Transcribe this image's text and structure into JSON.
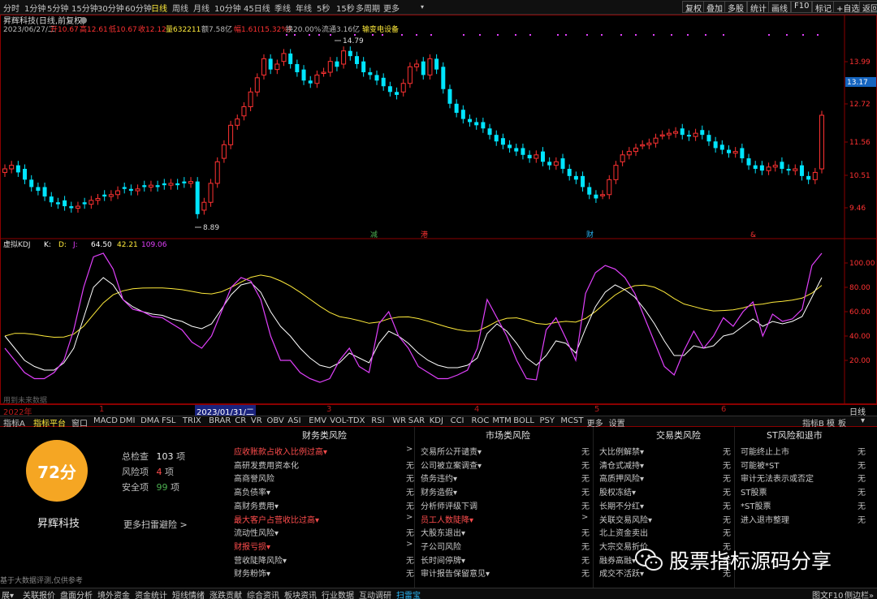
{
  "toolbar": {
    "periods": [
      "分时",
      "1分钟",
      "5分钟",
      "15分钟",
      "30分钟",
      "60分钟",
      "日线",
      "周线",
      "月线",
      "10分钟",
      "45日线",
      "季线",
      "年线",
      "5秒",
      "15秒",
      "多周期",
      "更多"
    ],
    "active_period": "日线",
    "right_buttons": [
      "复权",
      "叠加",
      "多股",
      "统计",
      "画线",
      "F10",
      "标记",
      "+自选",
      "返回"
    ]
  },
  "chart_header": {
    "title": "昇辉科技(日线,前复权)",
    "info_date": "2023/06/27/二",
    "info_open": "开10.67",
    "info_high": "高12.61",
    "info_low": "低10.67",
    "info_close": "收12.12",
    "info_vol": "量632211",
    "info_amount": "额7.58亿",
    "info_change": "幅1.61(15.32%)",
    "info_turnover": "换20.00%",
    "info_float": "流通3.16亿",
    "info_sector": "输变电设备",
    "high_marker": "14.79",
    "low_marker": "8.89",
    "price_ticks": [
      "13.99",
      "12.72",
      "11.56",
      "10.51",
      "9.46"
    ],
    "current_price": "13.17",
    "event_labels": [
      "减",
      "港",
      "财",
      "&"
    ]
  },
  "kdj": {
    "label": "虚拟KDJ",
    "legend_k": "K:",
    "legend_d": "D:",
    "legend_j": "J:",
    "value_1": "64.50",
    "value_2": "42.21",
    "value_3": "109.06",
    "ticks": [
      "100.00",
      "80.00",
      "60.00",
      "40.00",
      "20.00"
    ],
    "footnote": "用到未来数据"
  },
  "x_axis": {
    "labels": [
      "2022年",
      "1",
      "2023/01/31/二",
      "3",
      "4",
      "5",
      "6"
    ],
    "right_label": "日线"
  },
  "indicator_tabs": {
    "items": [
      "指标A",
      "指标平台",
      "窗口",
      "MACD",
      "DMI",
      "DMA",
      "FSL",
      "TRIX",
      "BRAR",
      "CR",
      "VR",
      "OBV",
      "ASI",
      "EMV",
      "VOL-TDX",
      "RSI",
      "WR",
      "SAR",
      "KDJ",
      "CCI",
      "ROC",
      "MTM",
      "BOLL",
      "PSY",
      "MCST",
      "更多",
      "设置"
    ],
    "right_items": [
      "指标B",
      "模",
      "板"
    ]
  },
  "risk": {
    "score": "72分",
    "stock_name": "昇辉科技",
    "total_label": "总检查",
    "total_value": "103",
    "total_unit": "项",
    "risk_label": "风险项",
    "risk_value": "4",
    "risk_unit": "项",
    "safe_label": "安全项",
    "safe_value": "99",
    "safe_unit": "项",
    "more_scan": "更多扫雷避险 >",
    "disclaimer": "基于大数据评测,仅供参考",
    "columns": [
      {
        "title": "财务类风险",
        "items": [
          {
            "label": "应收账款占收入比例过高▾",
            "value": ">",
            "alert": true
          },
          {
            "label": "高研发费用资本化",
            "value": "无",
            "alert": false
          },
          {
            "label": "高商誉风险",
            "value": "无",
            "alert": false
          },
          {
            "label": "高负债率▾",
            "value": "无",
            "alert": false
          },
          {
            "label": "高财务费用▾",
            "value": "无",
            "alert": false
          },
          {
            "label": "最大客户占营收比过高▾",
            "value": ">",
            "alert": true
          },
          {
            "label": "流动性风险▾",
            "value": "无",
            "alert": false
          },
          {
            "label": "财报亏损▾",
            "value": ">",
            "alert": true
          },
          {
            "label": "营收陡降风险▾",
            "value": "无",
            "alert": false
          },
          {
            "label": "财务粉饰▾",
            "value": "无",
            "alert": false
          }
        ]
      },
      {
        "title": "市场类风险",
        "items": [
          {
            "label": "交易所公开谴责▾",
            "value": "无",
            "alert": false
          },
          {
            "label": "公司被立案调查▾",
            "value": "无",
            "alert": false
          },
          {
            "label": "债务违约▾",
            "value": "无",
            "alert": false
          },
          {
            "label": "财务造假▾",
            "value": "无",
            "alert": false
          },
          {
            "label": "分析师评级下调",
            "value": "无",
            "alert": false
          },
          {
            "label": "员工人数陡降▾",
            "value": ">",
            "alert": true
          },
          {
            "label": "大股东退出▾",
            "value": "无",
            "alert": false
          },
          {
            "label": "子公司风险",
            "value": "无",
            "alert": false
          },
          {
            "label": "长时间停牌▾",
            "value": "无",
            "alert": false
          },
          {
            "label": "审计报告保留意见▾",
            "value": "无",
            "alert": false
          }
        ]
      },
      {
        "title": "交易类风险",
        "items": [
          {
            "label": "大比例解禁▾",
            "value": "无",
            "alert": false
          },
          {
            "label": "清仓式减持▾",
            "value": "无",
            "alert": false
          },
          {
            "label": "高质押风险▾",
            "value": "无",
            "alert": false
          },
          {
            "label": "股权冻结▾",
            "value": "无",
            "alert": false
          },
          {
            "label": "长期不分红▾",
            "value": "无",
            "alert": false
          },
          {
            "label": "关联交易风险▾",
            "value": "无",
            "alert": false
          },
          {
            "label": "北上资金卖出",
            "value": "无",
            "alert": false
          },
          {
            "label": "大宗交易折价",
            "value": "无",
            "alert": false
          },
          {
            "label": "融券高融▾",
            "value": "无",
            "alert": false
          },
          {
            "label": "成交不活跃▾",
            "value": "无",
            "alert": false
          }
        ]
      },
      {
        "title": "ST风险和退市",
        "items": [
          {
            "label": "可能终止上市",
            "value": "无",
            "alert": false
          },
          {
            "label": "可能被*ST",
            "value": "无",
            "alert": false
          },
          {
            "label": "审计无法表示或否定",
            "value": "无",
            "alert": false
          },
          {
            "label": "ST股票",
            "value": "无",
            "alert": false
          },
          {
            "label": "*ST股票",
            "value": "无",
            "alert": false
          },
          {
            "label": "进入退市整理",
            "value": "无",
            "alert": false
          }
        ]
      }
    ]
  },
  "watermark": "股票指标源码分享",
  "bottom_bar": {
    "items": [
      "展▾",
      "关联报价",
      "盘面分析",
      "境外资金",
      "资金统计",
      "短线情绪",
      "涨跌贡献",
      "综合资讯",
      "板块资讯",
      "行业数据",
      "互动调研",
      "扫雷宝"
    ],
    "active": "扫雷宝",
    "right": [
      "图文F10",
      "侧边栏»"
    ]
  },
  "colors": {
    "up": "#ff3232",
    "down": "#00e5ff",
    "k_line": "#ffffff",
    "d_line": "#ffeb3b",
    "j_line": "#e040fb",
    "score_circle": "#f5a623",
    "alert_text": "#ff4d4d"
  }
}
